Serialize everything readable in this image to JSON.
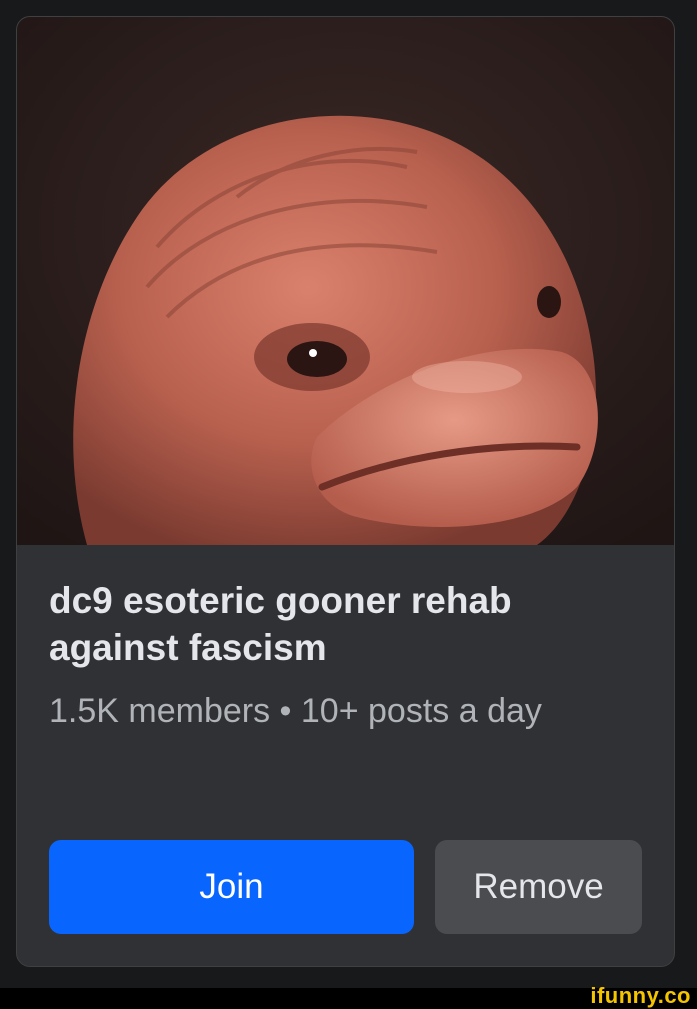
{
  "group_card": {
    "cover_image": "distorted-face-photo",
    "title": "dc9 esoteric gooner rehab against fascism",
    "meta": "1.5K members • 10+ posts a day",
    "join_label": "Join",
    "remove_label": "Remove"
  },
  "watermark": "ifunny.co",
  "colors": {
    "card_bg": "#303134",
    "join_bg": "#0866ff",
    "remove_bg": "#4b4c4f",
    "title_text": "#e4e6eb",
    "meta_text": "#b0b3b8",
    "watermark": "#f5c400"
  }
}
